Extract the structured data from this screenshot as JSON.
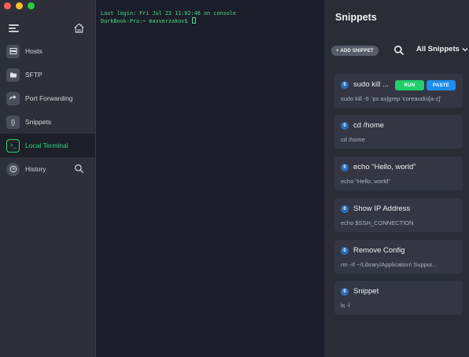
{
  "sidebar": {
    "items": [
      {
        "label": "Hosts",
        "icon": "hosts-icon"
      },
      {
        "label": "SFTP",
        "icon": "folder-icon"
      },
      {
        "label": "Port Forwarding",
        "icon": "port-forward-icon"
      },
      {
        "label": "Snippets",
        "icon": "braces-icon"
      },
      {
        "label": "Local Terminal",
        "icon": "terminal-icon",
        "active": true
      },
      {
        "label": "History",
        "icon": "clock-icon"
      }
    ]
  },
  "terminal": {
    "line1": "Last login: Fri Jul 23 11:02:46 on console",
    "line2": "DarkBook-Pro:~ maxverzakov$ "
  },
  "snippets": {
    "title": "Snippets",
    "add_label": "+ ADD SNIPPET",
    "filter_label": "All Snippets",
    "run_label": "RUN",
    "paste_label": "PASTE",
    "items": [
      {
        "name": "sudo kill ...",
        "cmd": "sudo kill -9 `ps ax|grep 'coreaudio[a-z]'"
      },
      {
        "name": "cd /home",
        "cmd": "cd /home"
      },
      {
        "name": "echo \"Hello, world\"",
        "cmd": "echo \"Hello, world\""
      },
      {
        "name": "Show IP Address",
        "cmd": "echo $SSH_CONNECTION"
      },
      {
        "name": "Remove Config",
        "cmd": "rm -rf ~/Library/Application\\ Suppor..."
      },
      {
        "name": "Snippet",
        "cmd": "ls -l"
      }
    ]
  },
  "colors": {
    "accent_green": "#2ed47a",
    "run_green": "#1fcf6b",
    "paste_blue": "#1d8ef0"
  }
}
